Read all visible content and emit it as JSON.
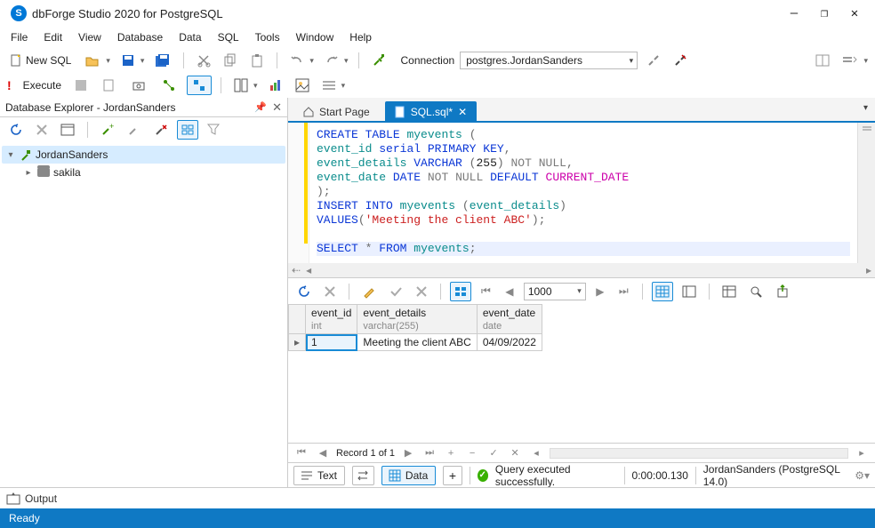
{
  "title": "dbForge Studio 2020 for PostgreSQL",
  "winbtn": {
    "min": "—",
    "max": "❐",
    "close": "✕"
  },
  "menu": [
    "File",
    "Edit",
    "View",
    "Database",
    "Data",
    "SQL",
    "Tools",
    "Window",
    "Help"
  ],
  "tb": {
    "new_sql": "New SQL",
    "conn_label": "Connection",
    "conn_value": "postgres.JordanSanders"
  },
  "tb2": {
    "execute": "Execute"
  },
  "dbx": {
    "title": "Database Explorer - JordanSanders",
    "conn": "JordanSanders",
    "items": [
      {
        "name": "sakila"
      }
    ]
  },
  "tabs": {
    "start": "Start Page",
    "sql": "SQL.sql*"
  },
  "sql": {
    "l1a": "CREATE",
    "l1b": "TABLE",
    "l1c": "myevents",
    "l2a": "event_id",
    "l2b": "serial",
    "l2c": "PRIMARY",
    "l2d": "KEY",
    "l3a": "event_details",
    "l3b": "VARCHAR",
    "l3num": "255",
    "l3c": "NOT",
    "l3d": "NULL",
    "l4a": "event_date",
    "l4b": "DATE",
    "l4c": "NOT",
    "l4d": "NULL",
    "l4e": "DEFAULT",
    "l4f": "CURRENT_DATE",
    "l6a": "INSERT",
    "l6b": "INTO",
    "l6c": "myevents",
    "l6d": "event_details",
    "l7a": "VALUES",
    "l7str": "'Meeting the client ABC'",
    "l9a": "SELECT",
    "l9b": "*",
    "l9c": "FROM",
    "l9d": "myevents"
  },
  "grid": {
    "page_size": "1000",
    "cols": [
      {
        "name": "event_id",
        "type": "int"
      },
      {
        "name": "event_details",
        "type": "varchar(255)"
      },
      {
        "name": "event_date",
        "type": "date"
      }
    ],
    "row": {
      "event_id": "1",
      "event_details": "Meeting the client ABC",
      "event_date": "04/09/2022"
    },
    "recnav": "Record 1 of 1"
  },
  "views": {
    "text": "Text",
    "data": "Data"
  },
  "status": {
    "msg": "Query executed successfully.",
    "time": "0:00:00.130",
    "conn": "JordanSanders (PostgreSQL 14.0)"
  },
  "output_label": "Output",
  "ready": "Ready"
}
